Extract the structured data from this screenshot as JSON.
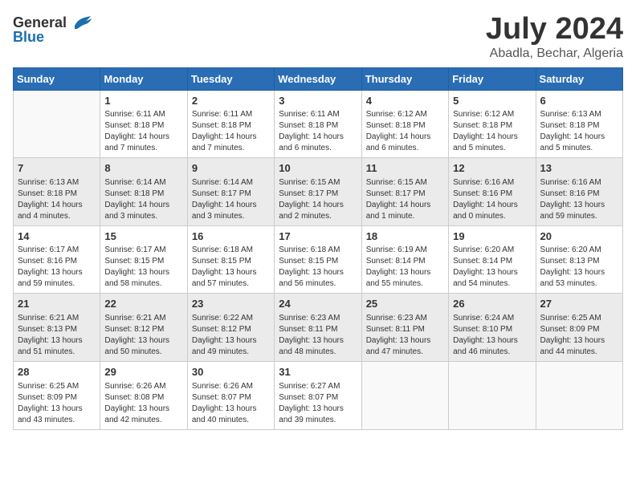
{
  "logo": {
    "general": "General",
    "blue": "Blue"
  },
  "title": "July 2024",
  "location": "Abadla, Bechar, Algeria",
  "weekdays": [
    "Sunday",
    "Monday",
    "Tuesday",
    "Wednesday",
    "Thursday",
    "Friday",
    "Saturday"
  ],
  "weeks": [
    [
      {
        "day": "",
        "info": ""
      },
      {
        "day": "1",
        "info": "Sunrise: 6:11 AM\nSunset: 8:18 PM\nDaylight: 14 hours\nand 7 minutes."
      },
      {
        "day": "2",
        "info": "Sunrise: 6:11 AM\nSunset: 8:18 PM\nDaylight: 14 hours\nand 7 minutes."
      },
      {
        "day": "3",
        "info": "Sunrise: 6:11 AM\nSunset: 8:18 PM\nDaylight: 14 hours\nand 6 minutes."
      },
      {
        "day": "4",
        "info": "Sunrise: 6:12 AM\nSunset: 8:18 PM\nDaylight: 14 hours\nand 6 minutes."
      },
      {
        "day": "5",
        "info": "Sunrise: 6:12 AM\nSunset: 8:18 PM\nDaylight: 14 hours\nand 5 minutes."
      },
      {
        "day": "6",
        "info": "Sunrise: 6:13 AM\nSunset: 8:18 PM\nDaylight: 14 hours\nand 5 minutes."
      }
    ],
    [
      {
        "day": "7",
        "info": "Sunrise: 6:13 AM\nSunset: 8:18 PM\nDaylight: 14 hours\nand 4 minutes."
      },
      {
        "day": "8",
        "info": "Sunrise: 6:14 AM\nSunset: 8:18 PM\nDaylight: 14 hours\nand 3 minutes."
      },
      {
        "day": "9",
        "info": "Sunrise: 6:14 AM\nSunset: 8:17 PM\nDaylight: 14 hours\nand 3 minutes."
      },
      {
        "day": "10",
        "info": "Sunrise: 6:15 AM\nSunset: 8:17 PM\nDaylight: 14 hours\nand 2 minutes."
      },
      {
        "day": "11",
        "info": "Sunrise: 6:15 AM\nSunset: 8:17 PM\nDaylight: 14 hours\nand 1 minute."
      },
      {
        "day": "12",
        "info": "Sunrise: 6:16 AM\nSunset: 8:16 PM\nDaylight: 14 hours\nand 0 minutes."
      },
      {
        "day": "13",
        "info": "Sunrise: 6:16 AM\nSunset: 8:16 PM\nDaylight: 13 hours\nand 59 minutes."
      }
    ],
    [
      {
        "day": "14",
        "info": "Sunrise: 6:17 AM\nSunset: 8:16 PM\nDaylight: 13 hours\nand 59 minutes."
      },
      {
        "day": "15",
        "info": "Sunrise: 6:17 AM\nSunset: 8:15 PM\nDaylight: 13 hours\nand 58 minutes."
      },
      {
        "day": "16",
        "info": "Sunrise: 6:18 AM\nSunset: 8:15 PM\nDaylight: 13 hours\nand 57 minutes."
      },
      {
        "day": "17",
        "info": "Sunrise: 6:18 AM\nSunset: 8:15 PM\nDaylight: 13 hours\nand 56 minutes."
      },
      {
        "day": "18",
        "info": "Sunrise: 6:19 AM\nSunset: 8:14 PM\nDaylight: 13 hours\nand 55 minutes."
      },
      {
        "day": "19",
        "info": "Sunrise: 6:20 AM\nSunset: 8:14 PM\nDaylight: 13 hours\nand 54 minutes."
      },
      {
        "day": "20",
        "info": "Sunrise: 6:20 AM\nSunset: 8:13 PM\nDaylight: 13 hours\nand 53 minutes."
      }
    ],
    [
      {
        "day": "21",
        "info": "Sunrise: 6:21 AM\nSunset: 8:13 PM\nDaylight: 13 hours\nand 51 minutes."
      },
      {
        "day": "22",
        "info": "Sunrise: 6:21 AM\nSunset: 8:12 PM\nDaylight: 13 hours\nand 50 minutes."
      },
      {
        "day": "23",
        "info": "Sunrise: 6:22 AM\nSunset: 8:12 PM\nDaylight: 13 hours\nand 49 minutes."
      },
      {
        "day": "24",
        "info": "Sunrise: 6:23 AM\nSunset: 8:11 PM\nDaylight: 13 hours\nand 48 minutes."
      },
      {
        "day": "25",
        "info": "Sunrise: 6:23 AM\nSunset: 8:11 PM\nDaylight: 13 hours\nand 47 minutes."
      },
      {
        "day": "26",
        "info": "Sunrise: 6:24 AM\nSunset: 8:10 PM\nDaylight: 13 hours\nand 46 minutes."
      },
      {
        "day": "27",
        "info": "Sunrise: 6:25 AM\nSunset: 8:09 PM\nDaylight: 13 hours\nand 44 minutes."
      }
    ],
    [
      {
        "day": "28",
        "info": "Sunrise: 6:25 AM\nSunset: 8:09 PM\nDaylight: 13 hours\nand 43 minutes."
      },
      {
        "day": "29",
        "info": "Sunrise: 6:26 AM\nSunset: 8:08 PM\nDaylight: 13 hours\nand 42 minutes."
      },
      {
        "day": "30",
        "info": "Sunrise: 6:26 AM\nSunset: 8:07 PM\nDaylight: 13 hours\nand 40 minutes."
      },
      {
        "day": "31",
        "info": "Sunrise: 6:27 AM\nSunset: 8:07 PM\nDaylight: 13 hours\nand 39 minutes."
      },
      {
        "day": "",
        "info": ""
      },
      {
        "day": "",
        "info": ""
      },
      {
        "day": "",
        "info": ""
      }
    ]
  ]
}
